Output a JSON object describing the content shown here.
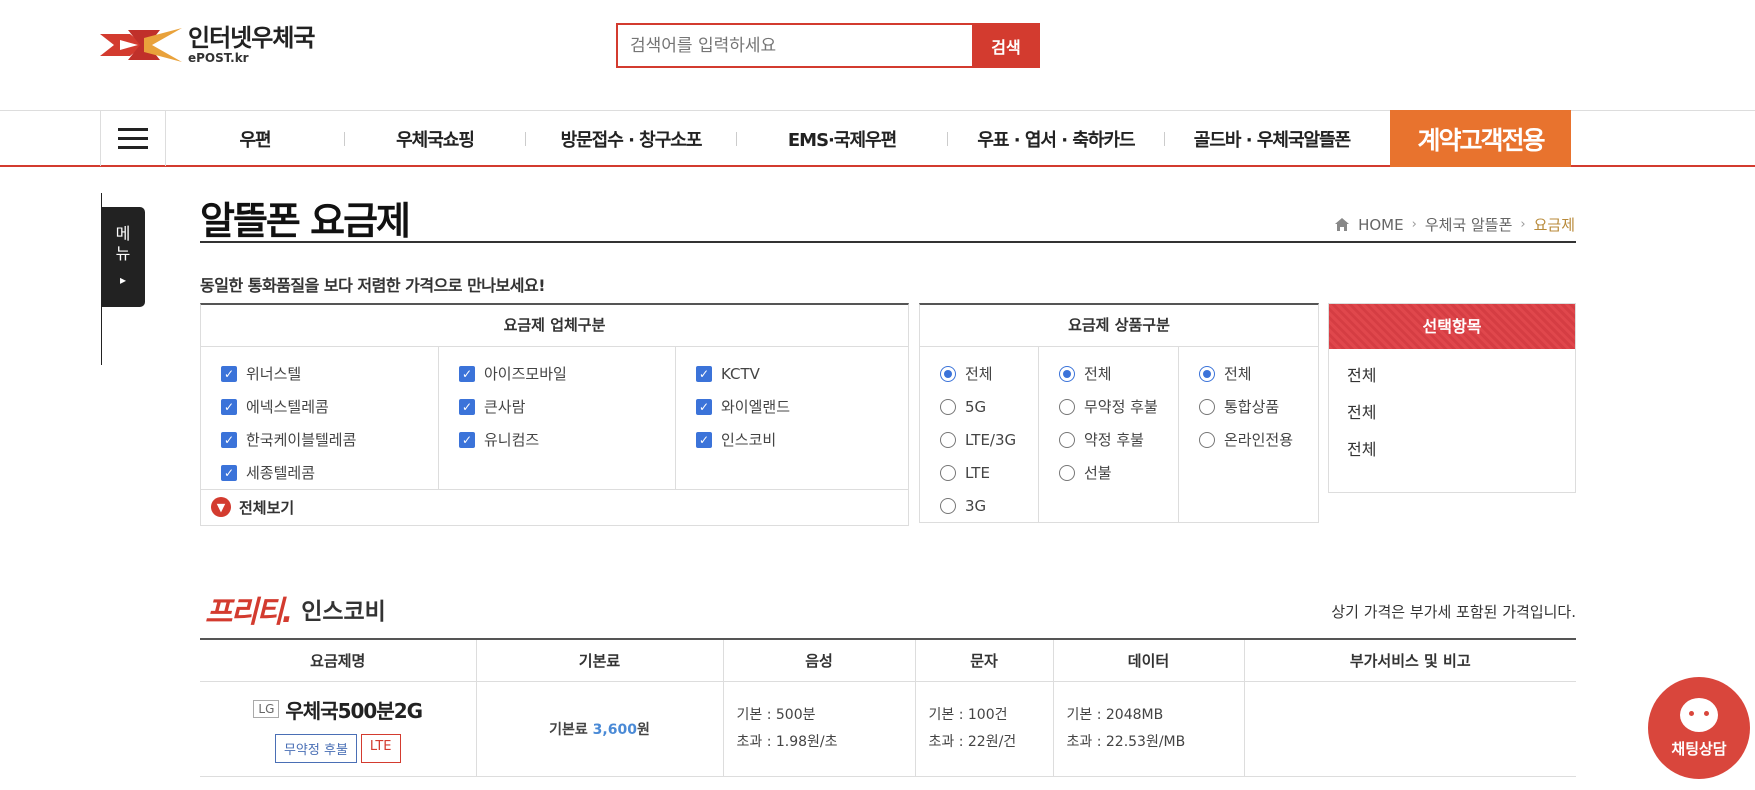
{
  "header": {
    "logo_title": "인터넷우체국",
    "logo_sub": "ePOST.kr",
    "search_placeholder": "검색어를 입력하세요",
    "search_button": "검색"
  },
  "nav": {
    "items": [
      "우편",
      "우체국쇼핑",
      "방문접수 · 창구소포",
      "EMS·국제우편",
      "우표 · 엽서 · 축하카드",
      "골드바 · 우체국알뜰폰"
    ],
    "contract": "계약고객전용"
  },
  "side_tab": {
    "line1": "메",
    "line2": "뉴",
    "arrow": "▸"
  },
  "page": {
    "title": "알뜰폰 요금제",
    "subtitle": "동일한 통화품질을 보다 저렴한 가격으로 만나보세요!",
    "breadcrumb": [
      "HOME",
      "우체국 알뜰폰",
      "요금제"
    ]
  },
  "carrier_filter": {
    "title": "요금제 업체구분",
    "columns": [
      [
        "위너스텔",
        "에넥스텔레콤",
        "한국케이블텔레콤",
        "세종텔레콤"
      ],
      [
        "아이즈모바일",
        "큰사람",
        "유니컴즈"
      ],
      [
        "KCTV",
        "와이엘랜드",
        "인스코비"
      ]
    ],
    "view_all": "전체보기"
  },
  "product_filter": {
    "title": "요금제 상품구분",
    "columns": [
      [
        {
          "label": "전체",
          "selected": true
        },
        {
          "label": "5G",
          "selected": false
        },
        {
          "label": "LTE/3G",
          "selected": false
        },
        {
          "label": "LTE",
          "selected": false
        },
        {
          "label": "3G",
          "selected": false
        }
      ],
      [
        {
          "label": "전체",
          "selected": true
        },
        {
          "label": "무약정 후불",
          "selected": false
        },
        {
          "label": "약정 후불",
          "selected": false
        },
        {
          "label": "선불",
          "selected": false
        }
      ],
      [
        {
          "label": "전체",
          "selected": true
        },
        {
          "label": "통합상품",
          "selected": false
        },
        {
          "label": "온라인전용",
          "selected": false
        }
      ]
    ]
  },
  "selection": {
    "title": "선택항목",
    "items": [
      "전체",
      "전체",
      "전체"
    ]
  },
  "plans_section": {
    "brand_logo": "프리티.",
    "brand_name": "인스코비",
    "vat_note": "상기 가격은 부가세 포함된 가격입니다.",
    "headers": [
      "요금제명",
      "기본료",
      "음성",
      "문자",
      "데이터",
      "부가서비스 및 비고"
    ],
    "rows": [
      {
        "carrier": "LG",
        "name": "우체국500분2G",
        "tags": [
          "무약정 후불",
          "LTE"
        ],
        "fee_label": "기본료",
        "fee_amount": "3,600",
        "fee_unit": "원",
        "voice_base": "기본 : 500분",
        "voice_over": "초과 : 1.98원/초",
        "sms_base": "기본 : 100건",
        "sms_over": "초과 : 22원/건",
        "data_base": "기본 : 2048MB",
        "data_over": "초과 : 22.53원/MB",
        "note": ""
      }
    ]
  },
  "chat": {
    "label": "채팅상담"
  },
  "colors": {
    "accent": "#d33b2f",
    "contract": "#e8732e",
    "checkbox": "#3b73d9"
  }
}
